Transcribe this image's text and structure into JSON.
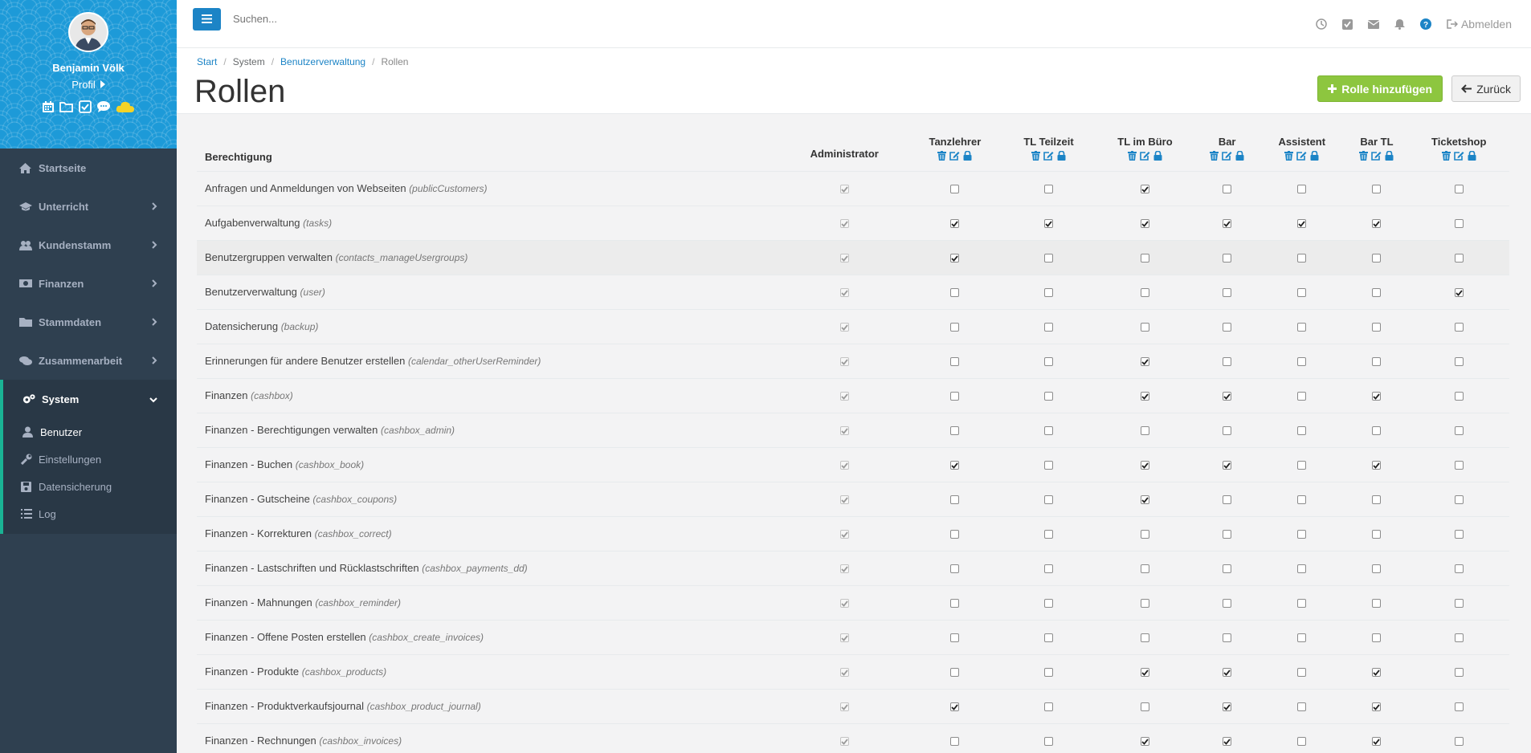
{
  "user": {
    "name": "Benjamin Völk",
    "profile_link": "Profil"
  },
  "sidebar": {
    "items": [
      {
        "label": "Startseite",
        "icon": "home-icon"
      },
      {
        "label": "Unterricht",
        "icon": "graduation-cap-icon"
      },
      {
        "label": "Kundenstamm",
        "icon": "users-icon"
      },
      {
        "label": "Finanzen",
        "icon": "money-icon"
      },
      {
        "label": "Stammdaten",
        "icon": "folder-icon"
      },
      {
        "label": "Zusammenarbeit",
        "icon": "comments-icon"
      },
      {
        "label": "System",
        "icon": "cogs-icon"
      }
    ],
    "subitems": [
      {
        "label": "Benutzer",
        "icon": "user-icon"
      },
      {
        "label": "Einstellungen",
        "icon": "wrench-icon"
      },
      {
        "label": "Datensicherung",
        "icon": "save-icon"
      },
      {
        "label": "Log",
        "icon": "list-icon"
      }
    ]
  },
  "topbar": {
    "search_placeholder": "Suchen...",
    "logout_label": "Abmelden"
  },
  "breadcrumb": {
    "start": "Start",
    "system": "System",
    "users": "Benutzerverwaltung",
    "current": "Rollen"
  },
  "page": {
    "title": "Rollen",
    "add_button": "Rolle hinzufügen",
    "back_button": "Zurück"
  },
  "table": {
    "permission_header": "Berechtigung",
    "roles": [
      "Administrator",
      "Tanzlehrer",
      "TL Teilzeit",
      "TL im Büro",
      "Bar",
      "Assistent",
      "Bar TL",
      "Ticketshop"
    ],
    "rows": [
      {
        "name": "Anfragen und Anmeldungen von Webseiten",
        "key": "(publicCustomers)",
        "checks": [
          1,
          0,
          0,
          1,
          0,
          0,
          0,
          0
        ]
      },
      {
        "name": "Aufgabenverwaltung",
        "key": "(tasks)",
        "checks": [
          1,
          1,
          1,
          1,
          1,
          1,
          1,
          0
        ]
      },
      {
        "name": "Benutzergruppen verwalten",
        "key": "(contacts_manageUsergroups)",
        "checks": [
          1,
          1,
          0,
          0,
          0,
          0,
          0,
          0
        ]
      },
      {
        "name": "Benutzerverwaltung",
        "key": "(user)",
        "checks": [
          1,
          0,
          0,
          0,
          0,
          0,
          0,
          1
        ]
      },
      {
        "name": "Datensicherung",
        "key": "(backup)",
        "checks": [
          1,
          0,
          0,
          0,
          0,
          0,
          0,
          0
        ]
      },
      {
        "name": "Erinnerungen für andere Benutzer erstellen",
        "key": "(calendar_otherUserReminder)",
        "checks": [
          1,
          0,
          0,
          1,
          0,
          0,
          0,
          0
        ]
      },
      {
        "name": "Finanzen",
        "key": "(cashbox)",
        "checks": [
          1,
          0,
          0,
          1,
          1,
          0,
          1,
          0
        ]
      },
      {
        "name": "Finanzen - Berechtigungen verwalten",
        "key": "(cashbox_admin)",
        "checks": [
          1,
          0,
          0,
          0,
          0,
          0,
          0,
          0
        ]
      },
      {
        "name": "Finanzen - Buchen",
        "key": "(cashbox_book)",
        "checks": [
          1,
          1,
          0,
          1,
          1,
          0,
          1,
          0
        ]
      },
      {
        "name": "Finanzen - Gutscheine",
        "key": "(cashbox_coupons)",
        "checks": [
          1,
          0,
          0,
          1,
          0,
          0,
          0,
          0
        ]
      },
      {
        "name": "Finanzen - Korrekturen",
        "key": "(cashbox_correct)",
        "checks": [
          1,
          0,
          0,
          0,
          0,
          0,
          0,
          0
        ]
      },
      {
        "name": "Finanzen - Lastschriften und Rücklastschriften",
        "key": "(cashbox_payments_dd)",
        "checks": [
          1,
          0,
          0,
          0,
          0,
          0,
          0,
          0
        ]
      },
      {
        "name": "Finanzen - Mahnungen",
        "key": "(cashbox_reminder)",
        "checks": [
          1,
          0,
          0,
          0,
          0,
          0,
          0,
          0
        ]
      },
      {
        "name": "Finanzen - Offene Posten erstellen",
        "key": "(cashbox_create_invoices)",
        "checks": [
          1,
          0,
          0,
          0,
          0,
          0,
          0,
          0
        ]
      },
      {
        "name": "Finanzen - Produkte",
        "key": "(cashbox_products)",
        "checks": [
          1,
          0,
          0,
          1,
          1,
          0,
          1,
          0
        ]
      },
      {
        "name": "Finanzen - Produktverkaufsjournal",
        "key": "(cashbox_product_journal)",
        "checks": [
          1,
          1,
          0,
          0,
          1,
          0,
          1,
          0
        ]
      },
      {
        "name": "Finanzen - Rechnungen",
        "key": "(cashbox_invoices)",
        "checks": [
          1,
          0,
          0,
          1,
          1,
          0,
          1,
          0
        ]
      }
    ]
  },
  "colors": {
    "sidebar_bg": "#2f4050",
    "profile_bg": "#1d9ad8",
    "accent_blue": "#1c84c6",
    "add_green": "#8dc63f",
    "active_border": "#1ab394"
  }
}
